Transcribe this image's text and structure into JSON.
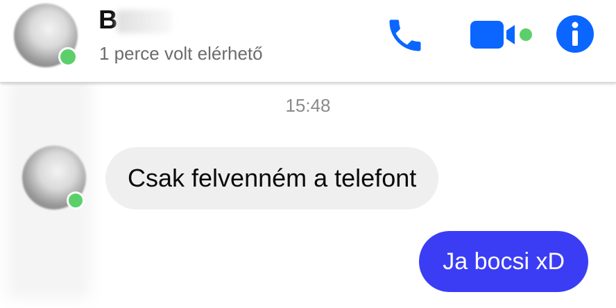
{
  "header": {
    "contact_name": "B",
    "status": "1 perce volt elérhető",
    "avatar_icon": "contact-avatar",
    "call_icon": "phone-icon",
    "video_icon": "video-camera-icon",
    "info_icon": "info-icon"
  },
  "conversation": {
    "timestamp": "15:48",
    "messages": [
      {
        "direction": "incoming",
        "text": "Csak felvenném a telefont"
      },
      {
        "direction": "outgoing",
        "text": "Ja bocsi xD"
      }
    ]
  },
  "colors": {
    "accent": "#0a66ff",
    "online": "#5bd06a",
    "outgoing_bubble": "#3b3df5",
    "incoming_bubble": "#efefef"
  }
}
